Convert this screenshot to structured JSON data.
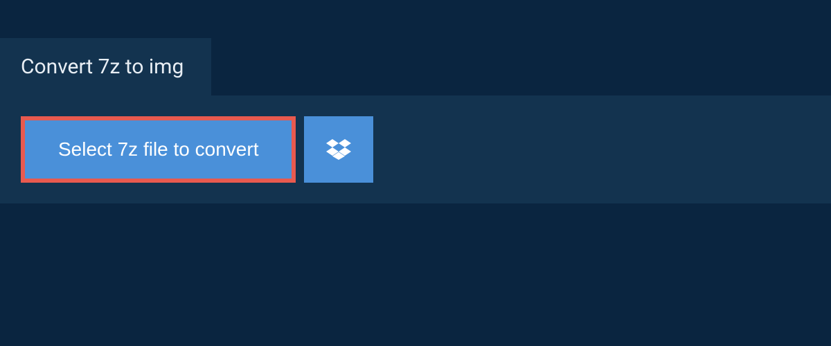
{
  "header": {
    "title": "Convert 7z to img"
  },
  "actions": {
    "select_file_label": "Select 7z file to convert"
  }
}
